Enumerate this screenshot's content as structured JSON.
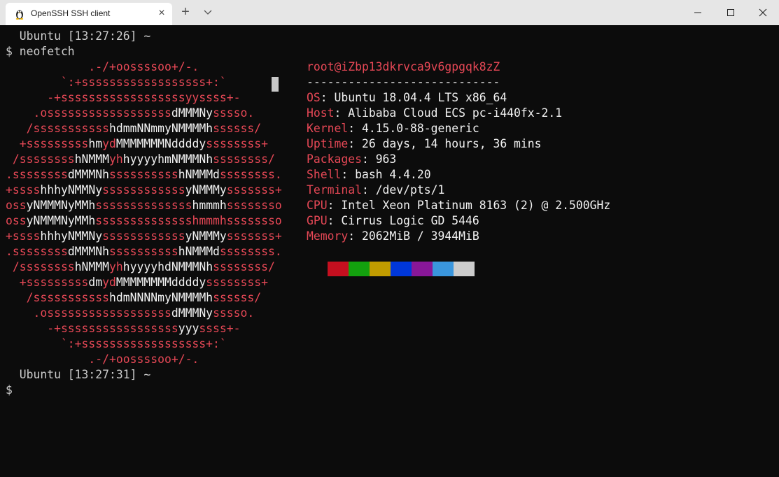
{
  "window": {
    "tab_title": "OpenSSH SSH client",
    "tab_icon": "tux-penguin-icon",
    "new_tab_symbol": "+"
  },
  "terminal": {
    "lines": [
      "  Ubuntu [13:27:26] ~",
      "$ neofetch",
      "",
      "",
      "",
      "",
      "",
      "",
      "",
      "",
      "",
      "",
      "",
      "",
      "",
      "",
      "",
      "",
      "",
      "",
      "",
      "",
      "  Ubuntu [13:27:31] ~",
      "$"
    ],
    "logo": [
      [
        [
          "r",
          "            .-/+oossssoo+/-."
        ]
      ],
      [
        [
          "r",
          "        `:+ssssssssssssssssss+:`"
        ]
      ],
      [
        [
          "r",
          "      -+ssssssssssssssssssyyssss+-"
        ]
      ],
      [
        [
          "r",
          "    .ossssssssssssssssss"
        ],
        [
          "w",
          "dMMMNy"
        ],
        [
          "r",
          "sssso."
        ]
      ],
      [
        [
          "r",
          "   /sssssssssss"
        ],
        [
          "w",
          "hdmmNNmmyNMMMMh"
        ],
        [
          "r",
          "ssssss/"
        ]
      ],
      [
        [
          "r",
          "  +sssssssss"
        ],
        [
          "w",
          "hm"
        ],
        [
          "r",
          "yd"
        ],
        [
          "w",
          "MMMMMMMNddddy"
        ],
        [
          "r",
          "ssssssss+"
        ]
      ],
      [
        [
          "r",
          " /ssssssss"
        ],
        [
          "w",
          "hNMMM"
        ],
        [
          "r",
          "yh"
        ],
        [
          "w",
          "hyyyyhmNMMMNh"
        ],
        [
          "r",
          "ssssssss/"
        ]
      ],
      [
        [
          "r",
          ".ssssssss"
        ],
        [
          "w",
          "dMMMNh"
        ],
        [
          "r",
          "ssssssssss"
        ],
        [
          "w",
          "hNMMMd"
        ],
        [
          "r",
          "ssssssss."
        ]
      ],
      [
        [
          "r",
          "+ssss"
        ],
        [
          "w",
          "hhhyNMMNy"
        ],
        [
          "r",
          "ssssssssssss"
        ],
        [
          "w",
          "yNMMMy"
        ],
        [
          "r",
          "sssssss+"
        ]
      ],
      [
        [
          "r",
          "oss"
        ],
        [
          "w",
          "yNMMMNyMMh"
        ],
        [
          "r",
          "ssssssssssssss"
        ],
        [
          "w",
          "hmmmh"
        ],
        [
          "r",
          "ssssssso"
        ]
      ],
      [
        [
          "r",
          "oss"
        ],
        [
          "w",
          "yNMMMNyMMh"
        ],
        [
          "r",
          "sssssssssssssshmmmh"
        ],
        [
          "r",
          "ssssssso"
        ]
      ],
      [
        [
          "r",
          "+ssss"
        ],
        [
          "w",
          "hhhyNMMNy"
        ],
        [
          "r",
          "ssssssssssss"
        ],
        [
          "w",
          "yNMMMy"
        ],
        [
          "r",
          "sssssss+"
        ]
      ],
      [
        [
          "r",
          ".ssssssss"
        ],
        [
          "w",
          "dMMMNh"
        ],
        [
          "r",
          "ssssssssss"
        ],
        [
          "w",
          "hNMMMd"
        ],
        [
          "r",
          "ssssssss."
        ]
      ],
      [
        [
          "r",
          " /ssssssss"
        ],
        [
          "w",
          "hNMMM"
        ],
        [
          "r",
          "yh"
        ],
        [
          "w",
          "hyyyyhdNMMMNh"
        ],
        [
          "r",
          "ssssssss/"
        ]
      ],
      [
        [
          "r",
          "  +sssssssss"
        ],
        [
          "w",
          "dm"
        ],
        [
          "r",
          "yd"
        ],
        [
          "w",
          "MMMMMMMMddddy"
        ],
        [
          "r",
          "ssssssss+"
        ]
      ],
      [
        [
          "r",
          "   /sssssssssss"
        ],
        [
          "w",
          "hdmNNNNmyNMMMMh"
        ],
        [
          "r",
          "ssssss/"
        ]
      ],
      [
        [
          "r",
          "    .ossssssssssssssssss"
        ],
        [
          "w",
          "dMMMNy"
        ],
        [
          "r",
          "sssso."
        ]
      ],
      [
        [
          "r",
          "      -+sssssssssssssssss"
        ],
        [
          "w",
          "yyy"
        ],
        [
          "r",
          "ssss+-"
        ]
      ],
      [
        [
          "r",
          "        `:+ssssssssssssssssss+:`"
        ]
      ],
      [
        [
          "r",
          "            .-/+oossssoo+/-."
        ]
      ]
    ],
    "info": [
      [
        [
          "r",
          "root@iZbp13dkrvca9v6gpgqk8zZ"
        ]
      ],
      [
        [
          "w",
          "----------------------------"
        ]
      ],
      [
        [
          "r",
          "OS"
        ],
        [
          "w",
          ": Ubuntu 18.04.4 LTS x86_64"
        ]
      ],
      [
        [
          "r",
          "Host"
        ],
        [
          "w",
          ": Alibaba Cloud ECS pc-i440fx-2.1"
        ]
      ],
      [
        [
          "r",
          "Kernel"
        ],
        [
          "w",
          ": 4.15.0-88-generic"
        ]
      ],
      [
        [
          "r",
          "Uptime"
        ],
        [
          "w",
          ": 26 days, 14 hours, 36 mins"
        ]
      ],
      [
        [
          "r",
          "Packages"
        ],
        [
          "w",
          ": 963"
        ]
      ],
      [
        [
          "r",
          "Shell"
        ],
        [
          "w",
          ": bash 4.4.20"
        ]
      ],
      [
        [
          "r",
          "Terminal"
        ],
        [
          "w",
          ": /dev/pts/1"
        ]
      ],
      [
        [
          "r",
          "CPU"
        ],
        [
          "w",
          ": Intel Xeon Platinum 8163 (2) @ 2.500GHz"
        ]
      ],
      [
        [
          "r",
          "GPU"
        ],
        [
          "w",
          ": Cirrus Logic GD 5446"
        ]
      ],
      [
        [
          "r",
          "Memory"
        ],
        [
          "w",
          ": 2062MiB / 3944MiB"
        ]
      ]
    ],
    "palette": [
      "#c50f1f",
      "#13a10e",
      "#c19c00",
      "#0037da",
      "#881798",
      "#3a96dd",
      "#cccccc"
    ],
    "colors": {
      "accent_red": "#e74856",
      "foreground": "#cccccc",
      "bright": "#f2f2f2",
      "background": "#0c0c0c"
    }
  }
}
